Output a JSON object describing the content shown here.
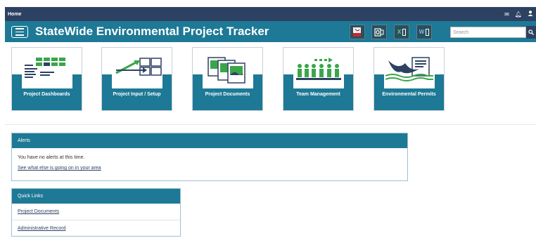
{
  "topbar": {
    "home_label": "Home",
    "icons": [
      "envelope-icon",
      "bell-icon",
      "user-icon"
    ]
  },
  "header": {
    "title": "StateWide Environmental Project Tracker"
  },
  "exports": [
    {
      "icon": "pdf-icon",
      "label": ""
    },
    {
      "icon": "outlook-icon",
      "label": ""
    },
    {
      "icon": "excel-icon",
      "label": "X"
    },
    {
      "icon": "word-icon",
      "label": "W"
    }
  ],
  "search": {
    "placeholder": "Search"
  },
  "tiles": [
    {
      "label": "Project Dashboards",
      "icon": "dashboard-icon"
    },
    {
      "label": "Project Input / Setup",
      "icon": "input-setup-icon"
    },
    {
      "label": "Project Documents",
      "icon": "documents-icon"
    },
    {
      "label": "Team Management",
      "icon": "team-icon"
    },
    {
      "label": "Environmental Permits",
      "icon": "permits-icon"
    }
  ],
  "alerts": {
    "title": "Alerts",
    "message": "You have no alerts at this time.",
    "link": "See what else is going on in your area"
  },
  "quick_links": {
    "title": "Quick Links",
    "items": [
      "Project Documents",
      "Administrative Record"
    ]
  },
  "colors": {
    "navy": "#2d4162",
    "teal": "#1d7996",
    "green": "#3aa64a"
  }
}
